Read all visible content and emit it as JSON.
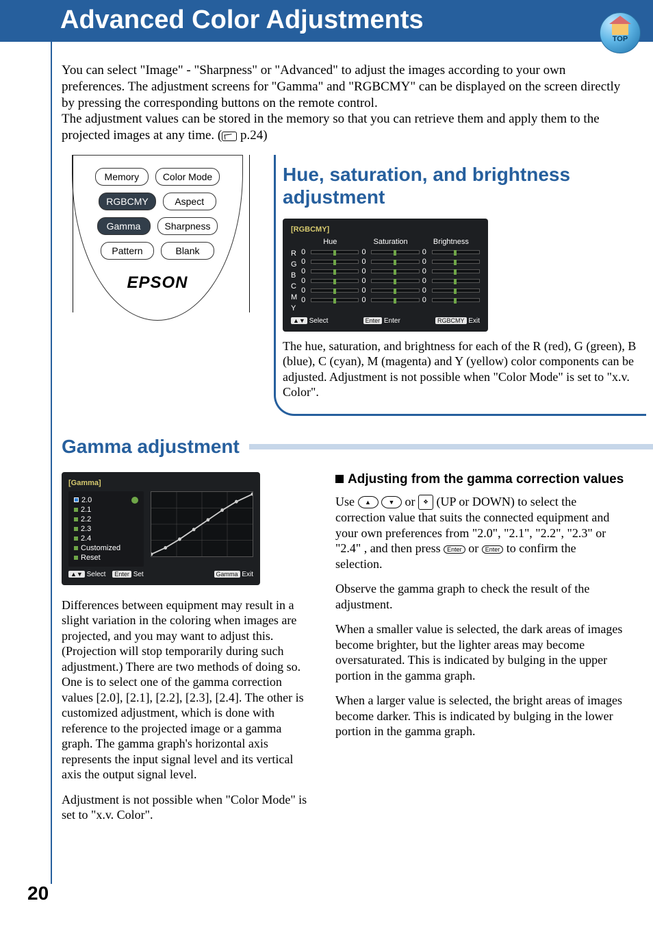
{
  "header": {
    "title": "Advanced Color Adjustments",
    "top_icon_label": "TOP"
  },
  "intro": "You can select \"Image\" - \"Sharpness\" or \"Advanced\" to adjust the images according to your own preferences. The adjustment screens for \"Gamma\" and \"RGBCMY\" can be displayed on the screen directly by pressing the corresponding buttons on the remote control.\nThe adjustment values can be stored in the memory so that you can retrieve them and apply them to the projected images at any time. (",
  "intro_ref": " p.24)",
  "remote": {
    "buttons": [
      [
        "Memory",
        "Color Mode"
      ],
      [
        "RGBCMY",
        "Aspect"
      ],
      [
        "Gamma",
        "Sharpness"
      ],
      [
        "Pattern",
        "Blank"
      ]
    ],
    "logo": "EPSON"
  },
  "hue_section": {
    "title": "Hue, saturation, and brightness adjustment",
    "osd_title": "[RGBCMY]",
    "columns": [
      "Hue",
      "Saturation",
      "Brightness"
    ],
    "rows": [
      "R",
      "G",
      "B",
      "C",
      "M",
      "Y"
    ],
    "value": "0",
    "foot": {
      "select": "Select",
      "enter": "Enter",
      "exit": "Exit",
      "enter_kb": "Enter",
      "exit_kb": "RGBCMY"
    },
    "text": "The hue, saturation, and brightness for each of the R (red), G (green), B (blue), C (cyan), M (magenta) and Y (yellow) color components can be adjusted. Adjustment is not possible when \"Color Mode\" is set to \"x.v. Color\"."
  },
  "gamma_section": {
    "title": "Gamma adjustment",
    "osd_title": "[Gamma]",
    "items": [
      "2.0",
      "2.1",
      "2.2",
      "2.3",
      "2.4",
      "Customized",
      "Reset"
    ],
    "selected": "2.0",
    "foot": {
      "select": "Select",
      "set": "Set",
      "exit": "Exit",
      "set_kb": "Enter",
      "exit_kb": "Gamma"
    },
    "para1": "Differences between equipment may result in a slight variation in the coloring when images are projected, and you may want to adjust this. (Projection will stop temporarily during such adjustment.) There are two methods of doing so. One is to select one of the gamma correction values [2.0], [2.1], [2.2], [2.3], [2.4]. The other is customized adjustment, which is done with reference to the projected image or a gamma graph. The gamma graph's horizontal axis represents the input signal level and its vertical axis the output signal level.",
    "para1b": "Adjustment is not possible when \"Color Mode\" is set to \"x.v. Color\"."
  },
  "gamma_right": {
    "subhead": "Adjusting from the gamma correction values",
    "p1a": "Use ",
    "p1b": " or ",
    "p1c": "(UP or DOWN) to select the correction value that suits the connected equipment and your own preferences from \"2.0\", \"2.1\", \"2.2\", \"2.3\" or \"2.4\" , and then press ",
    "p1d": " or ",
    "p1e": " to confirm the selection.",
    "p2": "Observe the gamma graph to check the result of the adjustment.",
    "p3": "When a smaller value is selected, the dark areas of images become brighter, but the lighter areas may become oversaturated. This is indicated by bulging in the upper portion in the gamma graph.",
    "p4": "When a larger value is selected, the bright areas of images become darker. This is indicated by bulging in the lower portion in the gamma graph."
  },
  "page_number": "20"
}
